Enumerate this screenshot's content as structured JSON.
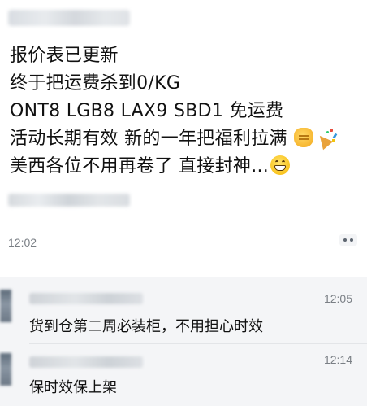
{
  "post": {
    "lines": [
      "报价表已更新",
      "终于把运费杀到0/KG",
      "ONT8 LGB8 LAX9 SBD1 免运费",
      "活动长期有效  新的一年把福利拉满",
      "美西各位不用再卷了 直接封神..."
    ],
    "time": "12:02",
    "emojis": [
      "fist-emoji",
      "party-popper-emoji",
      "grinning-emoji"
    ]
  },
  "comments": [
    {
      "time": "12:05",
      "text": "货到仓第二周必装柜，不用担心时效"
    },
    {
      "time": "12:14",
      "text": "保时效保上架"
    }
  ],
  "colors": {
    "text": "#111111",
    "timestamp": "#7a7f85",
    "comment_bg": "#f4f5f7"
  }
}
